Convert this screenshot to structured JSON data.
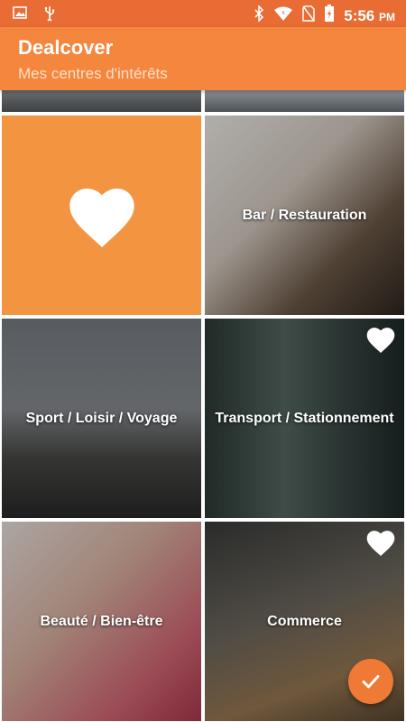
{
  "status_bar": {
    "time": "5:56",
    "ampm": "PM",
    "left_icons": [
      "image-icon",
      "usb-icon"
    ],
    "right_icons": [
      "bluetooth-icon",
      "wifi-icon",
      "no-sim-icon",
      "battery-icon"
    ]
  },
  "app_bar": {
    "title": "Dealcover",
    "subtitle": "Mes centres d'intérêts"
  },
  "categories": [
    {
      "label": "",
      "selected": true
    },
    {
      "label": "Bar / Restauration",
      "selected": false
    },
    {
      "label": "Sport / Loisir / Voyage",
      "selected": false
    },
    {
      "label": "Transport / Stationnement",
      "selected": true
    },
    {
      "label": "Beauté / Bien-être",
      "selected": false
    },
    {
      "label": "Commerce",
      "selected": true
    }
  ],
  "fab": {
    "icon": "check-icon"
  },
  "colors": {
    "status_bar": "#e86c33",
    "app_bar": "#f4863e",
    "accent": "#ee7a36",
    "tile_selected": "#f29440"
  }
}
